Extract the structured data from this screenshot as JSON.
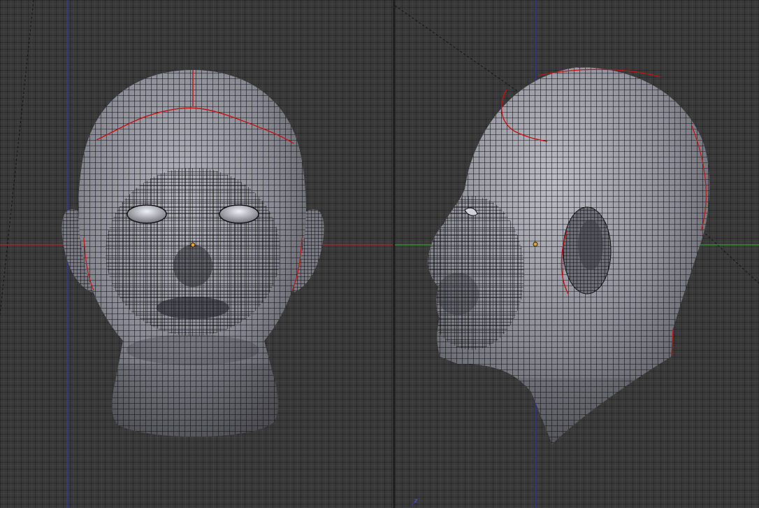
{
  "colors": {
    "background": "#393939",
    "grid_line": "#2e2e2e",
    "x_axis": "#b03030",
    "y_axis": "#3a9a3a",
    "z_axis": "#3333aa",
    "mesh_surface": "#8c8c96",
    "mesh_wire": "#0a0a0a",
    "seam": "#c01010",
    "eye": "#c8c8d0",
    "origin": "#e8a020"
  },
  "viewports": [
    {
      "name": "front",
      "view": "front-orthographic"
    },
    {
      "name": "side",
      "view": "right-orthographic"
    }
  ],
  "icons": {
    "origin": "origin-dot-icon",
    "axis_gizmo": "axis-gizmo-icon"
  }
}
